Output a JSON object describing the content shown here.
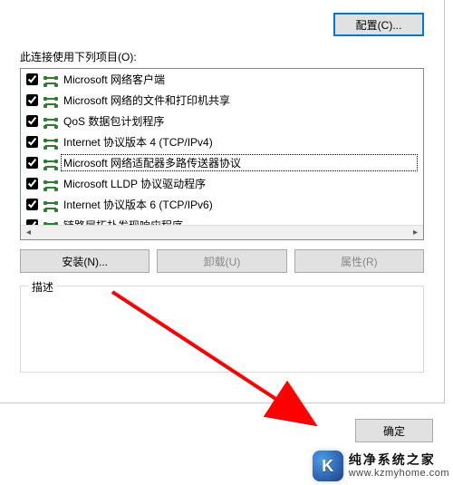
{
  "buttons": {
    "configure": "配置(C)...",
    "install": "安装(N)...",
    "uninstall": "卸载(U)",
    "properties": "属性(R)",
    "ok": "确定"
  },
  "labels": {
    "uses_items": "此连接使用下列项目(O):",
    "description": "描述"
  },
  "items": [
    {
      "checked": true,
      "label": "Microsoft 网络客户端",
      "selected": false
    },
    {
      "checked": true,
      "label": "Microsoft 网络的文件和打印机共享",
      "selected": false
    },
    {
      "checked": true,
      "label": "QoS 数据包计划程序",
      "selected": false
    },
    {
      "checked": true,
      "label": "Internet 协议版本 4 (TCP/IPv4)",
      "selected": false
    },
    {
      "checked": true,
      "label": "Microsoft 网络适配器多路传送器协议",
      "selected": true
    },
    {
      "checked": true,
      "label": "Microsoft LLDP 协议驱动程序",
      "selected": false
    },
    {
      "checked": true,
      "label": "Internet 协议版本 6 (TCP/IPv6)",
      "selected": false
    },
    {
      "checked": true,
      "label": "链路层拓扑发现响应程序",
      "selected": false
    }
  ],
  "watermark": {
    "title": "纯净系统之家",
    "url": "www.kzmyhome.com",
    "logo_letter": "K"
  },
  "colors": {
    "focus": "#0078d7",
    "arrow": "#ff0000"
  }
}
